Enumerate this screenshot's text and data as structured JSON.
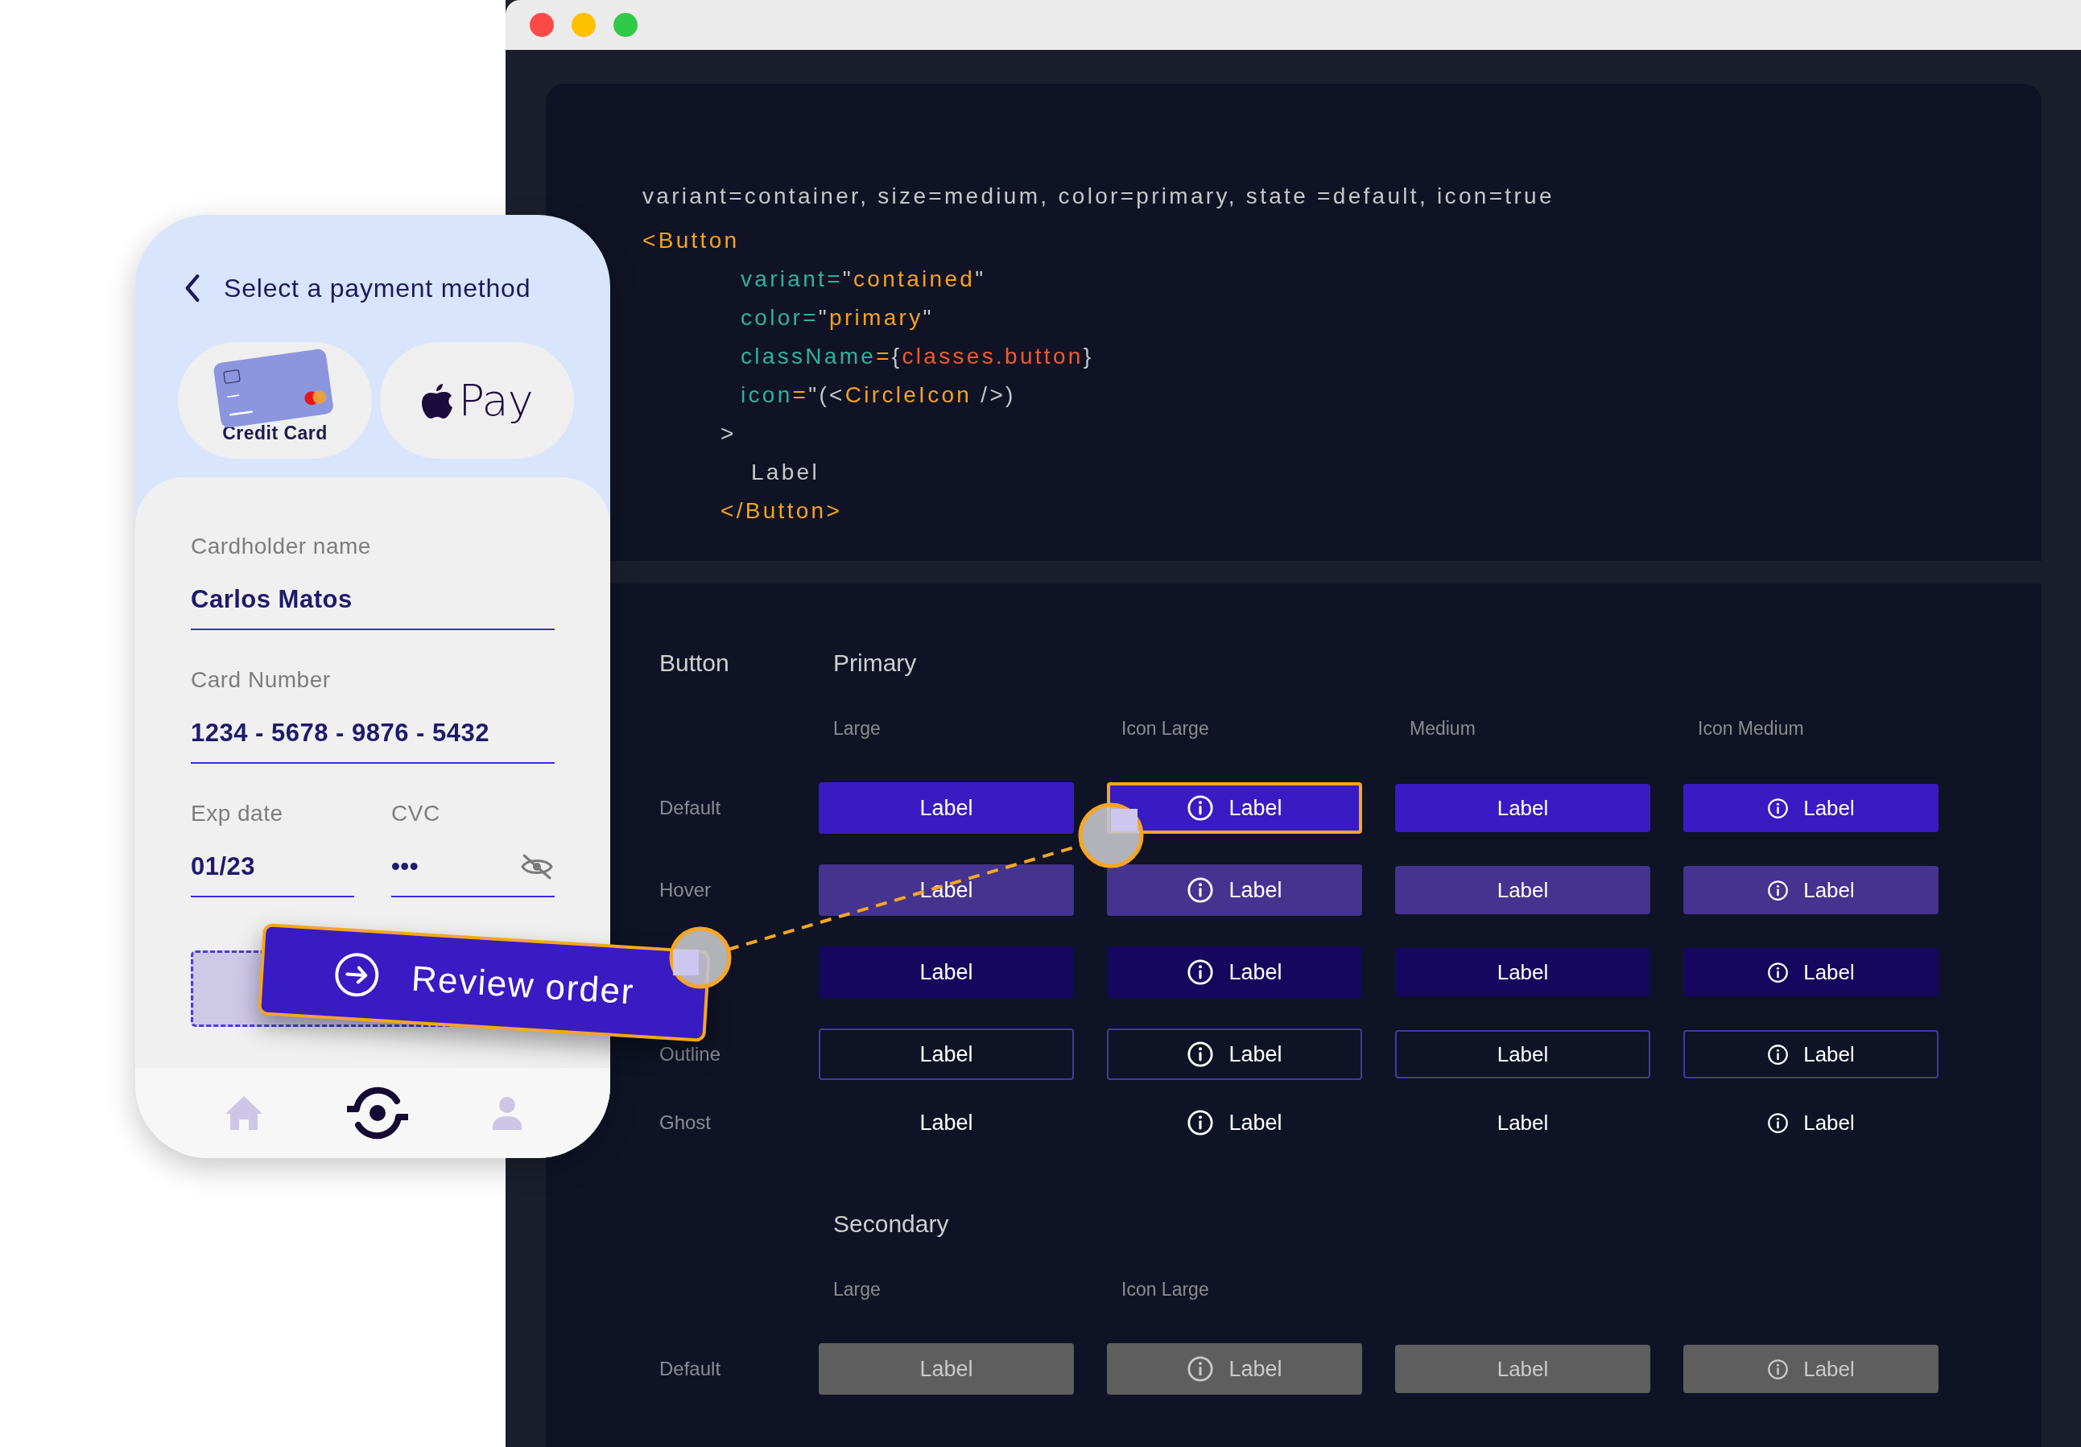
{
  "browser_window": {
    "code_panel": {
      "lines": [
        {
          "kind": "summary",
          "tokens": [
            {
              "kind": "plain",
              "text": "variant=container, size=medium, color=primary, state =default, icon=true"
            }
          ]
        },
        {
          "kind": "tag-open",
          "tokens": [
            {
              "kind": "tag",
              "text": "<Button"
            }
          ]
        },
        {
          "kind": "prop",
          "tokens": [
            {
              "kind": "attr",
              "text": "variant="
            },
            {
              "kind": "plain",
              "text": "\""
            },
            {
              "kind": "string",
              "text": "contained"
            },
            {
              "kind": "plain",
              "text": "\""
            }
          ]
        },
        {
          "kind": "prop",
          "tokens": [
            {
              "kind": "attr",
              "text": "color="
            },
            {
              "kind": "plain",
              "text": "\""
            },
            {
              "kind": "string",
              "text": "primary"
            },
            {
              "kind": "plain",
              "text": "\""
            }
          ]
        },
        {
          "kind": "prop",
          "tokens": [
            {
              "kind": "attr",
              "text": "className"
            },
            {
              "kind": "string",
              "text": "="
            },
            {
              "kind": "plain",
              "text": "{"
            },
            {
              "kind": "expr",
              "text": "classes.button"
            },
            {
              "kind": "plain",
              "text": "}"
            }
          ]
        },
        {
          "kind": "prop",
          "tokens": [
            {
              "kind": "attr",
              "text": "icon"
            },
            {
              "kind": "string",
              "text": "="
            },
            {
              "kind": "plain",
              "text": "\"(<"
            },
            {
              "kind": "string",
              "text": "CircleIcon"
            },
            {
              "kind": "plain",
              "text": " />)"
            }
          ]
        },
        {
          "kind": "bracket",
          "tokens": [
            {
              "kind": "plain",
              "text": ">"
            }
          ]
        },
        {
          "kind": "content",
          "tokens": [
            {
              "kind": "plain",
              "text": "Label"
            }
          ]
        },
        {
          "kind": "tag-close",
          "tokens": [
            {
              "kind": "tag",
              "text": "</Button>"
            }
          ]
        }
      ]
    },
    "button_grid": {
      "title": "Button",
      "sections": [
        {
          "title": "Primary",
          "kind": "primary",
          "columns": [
            "Large",
            "Icon Large",
            "Medium",
            "Icon Medium"
          ],
          "rows": [
            {
              "label": "Default",
              "kind": "default",
              "buttons": [
                {
                  "label": "Label",
                  "kind": "large",
                  "icon": false,
                  "highlighted": false
                },
                {
                  "label": "Label",
                  "kind": "large",
                  "icon": true,
                  "highlighted": true
                },
                {
                  "label": "Label",
                  "kind": "medium",
                  "icon": false,
                  "highlighted": false
                },
                {
                  "label": "Label",
                  "kind": "medium",
                  "icon": true,
                  "highlighted": false
                }
              ]
            },
            {
              "label": "Hover",
              "kind": "hover",
              "buttons": [
                {
                  "label": "Label",
                  "kind": "large",
                  "icon": false,
                  "highlighted": false
                },
                {
                  "label": "Label",
                  "kind": "large",
                  "icon": true,
                  "highlighted": false
                },
                {
                  "label": "Label",
                  "kind": "medium",
                  "icon": false,
                  "highlighted": false
                },
                {
                  "label": "Label",
                  "kind": "medium",
                  "icon": true,
                  "highlighted": false
                }
              ]
            },
            {
              "kind": "pressed",
              "buttons": [
                {
                  "label": "Label",
                  "kind": "large",
                  "icon": false,
                  "highlighted": false
                },
                {
                  "label": "Label",
                  "kind": "large",
                  "icon": true,
                  "highlighted": false
                },
                {
                  "label": "Label",
                  "kind": "medium",
                  "icon": false,
                  "highlighted": false
                },
                {
                  "label": "Label",
                  "kind": "medium",
                  "icon": true,
                  "highlighted": false
                }
              ]
            },
            {
              "label": "Outline",
              "kind": "outline",
              "buttons": [
                {
                  "label": "Label",
                  "kind": "large",
                  "icon": false,
                  "highlighted": false
                },
                {
                  "label": "Label",
                  "kind": "large",
                  "icon": true,
                  "highlighted": false
                },
                {
                  "label": "Label",
                  "kind": "medium",
                  "icon": false,
                  "highlighted": false
                },
                {
                  "label": "Label",
                  "kind": "medium",
                  "icon": true,
                  "highlighted": false
                }
              ]
            },
            {
              "label": "Ghost",
              "kind": "ghost",
              "buttons": [
                {
                  "label": "Label",
                  "kind": "large",
                  "icon": false,
                  "highlighted": false
                },
                {
                  "label": "Label",
                  "kind": "large",
                  "icon": true,
                  "highlighted": false
                },
                {
                  "label": "Label",
                  "kind": "medium",
                  "icon": false,
                  "highlighted": false
                },
                {
                  "label": "Label",
                  "kind": "medium",
                  "icon": true,
                  "highlighted": false
                }
              ]
            }
          ]
        },
        {
          "title": "Secondary",
          "kind": "secondary",
          "columns": [
            "Large",
            "Icon Large"
          ],
          "rows": [
            {
              "label": "Default",
              "kind": "default",
              "buttons": [
                {
                  "label": "Label",
                  "kind": "large",
                  "icon": false,
                  "highlighted": false
                },
                {
                  "label": "Label",
                  "kind": "large",
                  "icon": true,
                  "highlighted": false
                },
                {
                  "label": "Label",
                  "kind": "medium",
                  "icon": false,
                  "highlighted": false
                },
                {
                  "label": "Label",
                  "kind": "medium",
                  "icon": true,
                  "highlighted": false
                }
              ]
            }
          ]
        }
      ]
    }
  },
  "phone": {
    "header": {
      "title": "Select a payment method"
    },
    "payment_methods": [
      {
        "kind": "card",
        "label": "Credit Card"
      },
      {
        "kind": "apple_pay",
        "label": "Pay"
      }
    ],
    "fields": [
      {
        "label": "Cardholder name",
        "value": "Carlos Matos"
      },
      {
        "label": "Card Number",
        "value": "1234 - 5678 - 9876 - 5432"
      }
    ],
    "half_fields": [
      {
        "label": "Exp date",
        "value": "01/23",
        "masked": false
      },
      {
        "label": "CVC",
        "value": "•••",
        "masked": true
      }
    ],
    "floating_button": {
      "label": "Review order"
    },
    "nav": [
      {
        "kind": "home",
        "selected": false
      },
      {
        "kind": "eye",
        "selected": true
      },
      {
        "kind": "user",
        "selected": false
      }
    ]
  }
}
